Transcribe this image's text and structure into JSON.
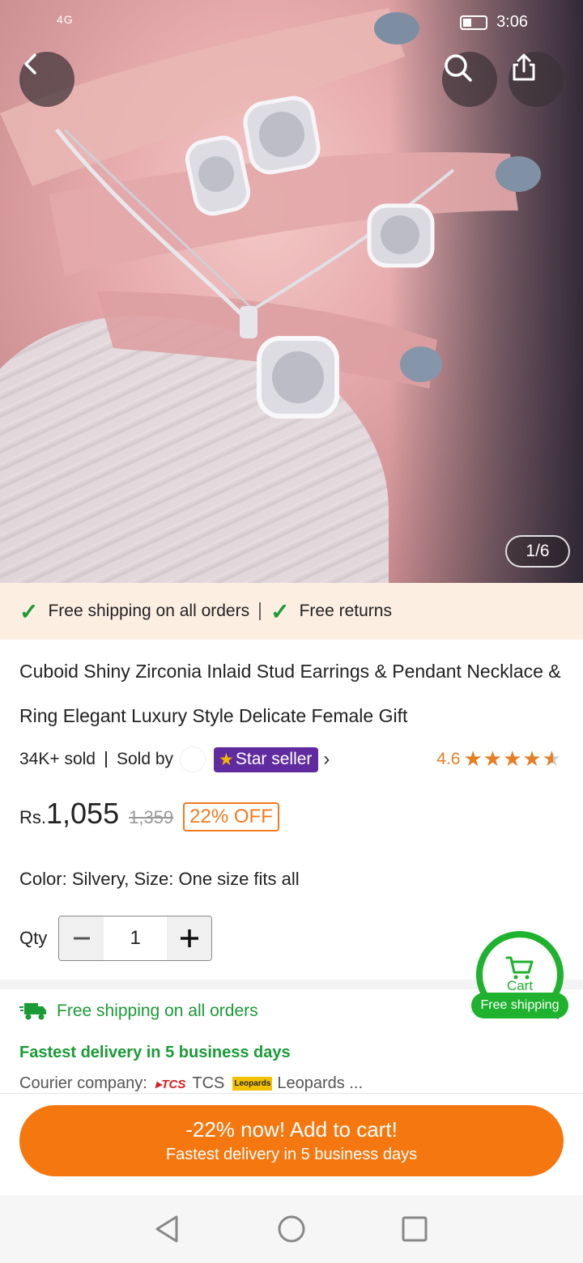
{
  "status": {
    "network": "4G",
    "time": "3:06"
  },
  "hero": {
    "counter": "1/6"
  },
  "colors": {
    "accent": "#f5770f",
    "green": "#1fb22f",
    "star_seller_bg": "#5f2b9e"
  },
  "shipping_strip": {
    "item1": "Free shipping on all orders",
    "item2": "Free returns"
  },
  "product": {
    "title": "Cuboid Shiny Zirconia Inlaid Stud Earrings & Pendant Necklace & Ring Elegant Luxury Style Delicate Female Gift",
    "sold": "34K+ sold",
    "sold_by": "Sold by",
    "star_seller": "Star seller",
    "rating": "4.6",
    "currency": "Rs.",
    "price": "1,055",
    "old_price": "1,359",
    "discount": "22% OFF",
    "color_label": "Color:",
    "color_value": "Silvery,",
    "size_label": "Size:",
    "size_value": "One size fits all",
    "qty_label": "Qty",
    "qty_value": "1"
  },
  "delivery": {
    "free_shipping": "Free shipping on all orders",
    "fastest": "Fastest delivery in 5 business days",
    "courier_label": "Courier company:",
    "courier1": "TCS",
    "courier2": "Leopards ..."
  },
  "cart_float": {
    "label": "Cart",
    "tag": "Free shipping"
  },
  "cta": {
    "line1": "-22% now! Add to cart!",
    "line2": "Fastest delivery in 5 business days"
  }
}
